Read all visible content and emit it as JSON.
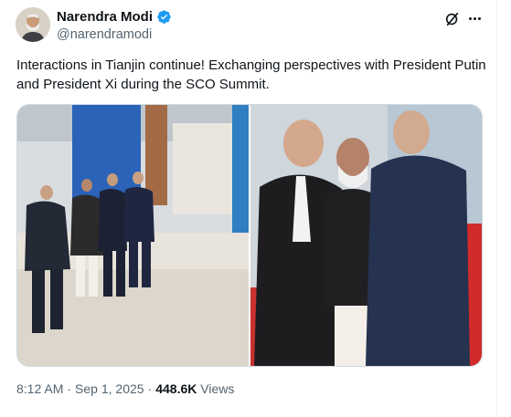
{
  "author": {
    "display_name": "Narendra Modi",
    "handle": "@narendramodi",
    "verified": true
  },
  "icons": {
    "verified": "verified-badge-icon",
    "grok": "grok-icon",
    "more": "more-options-icon"
  },
  "tweet": {
    "text": "Interactions in Tianjin continue! Exchanging perspectives with President Putin and President Xi during the SCO Summit."
  },
  "media": {
    "count": 2
  },
  "meta": {
    "time": "8:12 AM",
    "separator1": "·",
    "date": "Sep 1, 2025",
    "separator2": "·",
    "views_count": "448.6K",
    "views_label": "Views"
  },
  "colors": {
    "verified_blue": "#1d9bf0",
    "text": "#0f1419",
    "secondary": "#536471"
  }
}
